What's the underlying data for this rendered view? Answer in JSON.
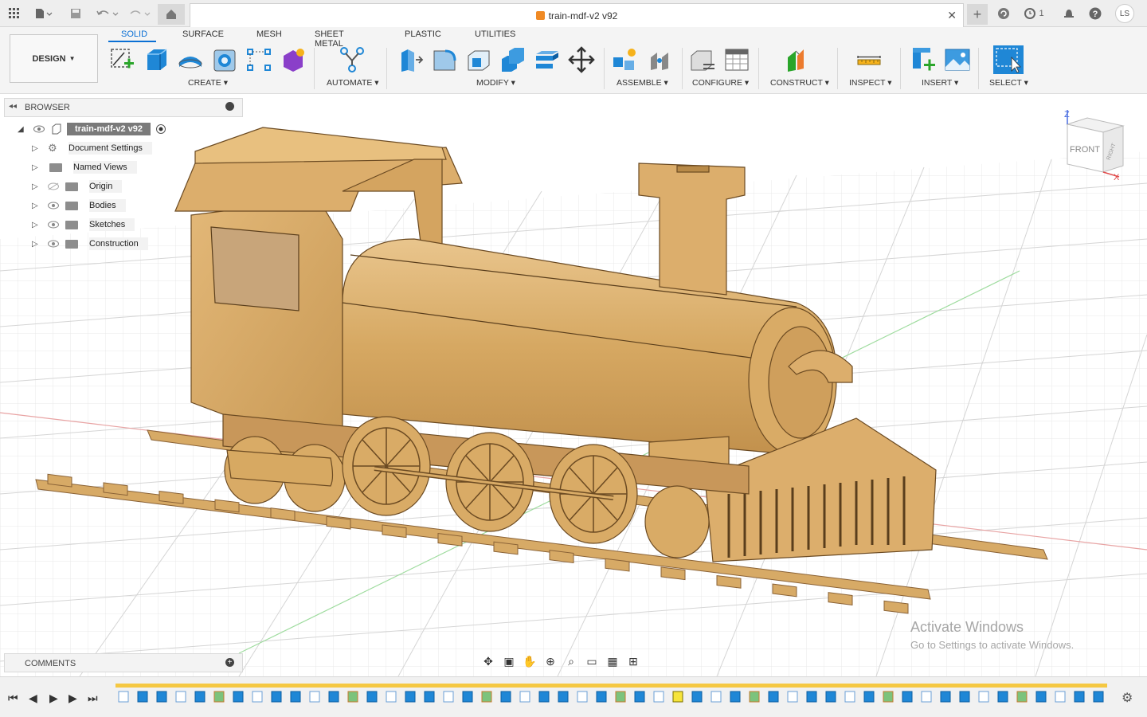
{
  "title_bar": {
    "document_title": "train-mdf-v2 v92",
    "notification_count": "1",
    "user_initials": "LS"
  },
  "toolbar": {
    "workspace_label": "DESIGN",
    "tabs": [
      "SOLID",
      "SURFACE",
      "MESH",
      "SHEET METAL",
      "PLASTIC",
      "UTILITIES"
    ],
    "active_tab": "SOLID",
    "groups": {
      "create": "CREATE",
      "automate": "AUTOMATE",
      "modify": "MODIFY",
      "assemble": "ASSEMBLE",
      "configure": "CONFIGURE",
      "construct": "CONSTRUCT",
      "inspect": "INSPECT",
      "insert": "INSERT",
      "select": "SELECT"
    }
  },
  "browser": {
    "header": "BROWSER",
    "root": "train-mdf-v2 v92",
    "items": [
      {
        "label": "Document Settings",
        "icon": "gear-icon"
      },
      {
        "label": "Named Views",
        "icon": "folder-icon"
      },
      {
        "label": "Origin",
        "icon": "folder-icon",
        "hidden": true
      },
      {
        "label": "Bodies",
        "icon": "folder-icon"
      },
      {
        "label": "Sketches",
        "icon": "folder-icon"
      },
      {
        "label": "Construction",
        "icon": "folder-icon"
      }
    ]
  },
  "comments": {
    "header": "COMMENTS"
  },
  "viewcube": {
    "front": "FRONT",
    "right": "RIGHT",
    "z_axis": "Z",
    "x_axis": "X"
  },
  "watermark": {
    "line1": "Activate Windows",
    "line2": "Go to Settings to activate Windows."
  },
  "colors": {
    "accent": "#0a6fd4",
    "wood": "#d9ad6b",
    "wood_dark": "#b98a4a",
    "timeline_bar": "#f5c842"
  }
}
